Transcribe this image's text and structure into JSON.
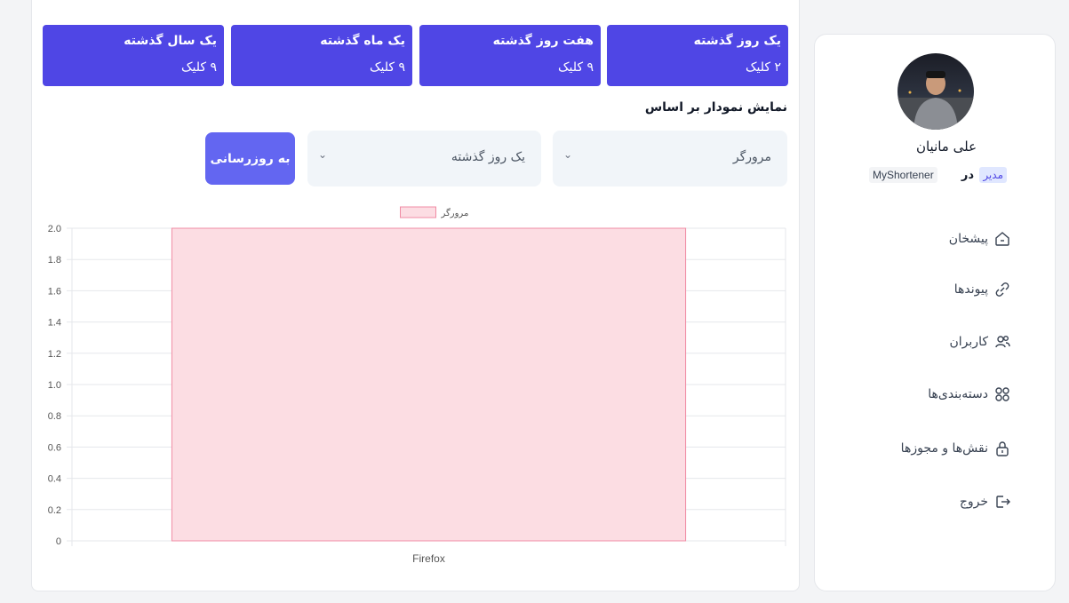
{
  "stats": [
    {
      "title": "یک روز گذشته",
      "value": "۲ کلیک"
    },
    {
      "title": "هفت روز گذشته",
      "value": "۹ کلیک"
    },
    {
      "title": "یک ماه گذشته",
      "value": "۹ کلیک"
    },
    {
      "title": "یک سال گذشته",
      "value": "۹ کلیک"
    }
  ],
  "filters": {
    "heading": "نمایش نمودار بر اساس",
    "type_value": "مرورگر",
    "period_value": "یک روز گذشته",
    "update_label": "به روزرسانی"
  },
  "colors": {
    "accent": "#4f46e5",
    "button": "#6366f1",
    "bar_fill": "#fcdde3",
    "bar_stroke": "#f08ca4"
  },
  "chart_data": {
    "type": "bar",
    "categories": [
      "Firefox"
    ],
    "series": [
      {
        "name": "مرورگر",
        "values": [
          2
        ]
      }
    ],
    "ylim": [
      0,
      2
    ],
    "yticks": [
      "0",
      "0.2",
      "0.4",
      "0.6",
      "0.8",
      "1.0",
      "1.2",
      "1.4",
      "1.6",
      "1.8",
      "2.0"
    ],
    "grid": true,
    "legend": "top"
  },
  "profile": {
    "name": "علی مانیان",
    "role": "مدیر",
    "in_word": "در",
    "org": "MyShortener"
  },
  "nav": [
    {
      "label": "پیشخان",
      "icon": "dashboard-icon"
    },
    {
      "label": "پیوندها",
      "icon": "link-icon"
    },
    {
      "label": "کاربران",
      "icon": "users-icon"
    },
    {
      "label": "دسته‌بندی‌ها",
      "icon": "categories-icon"
    },
    {
      "label": "نقش‌ها و مجوزها",
      "icon": "lock-icon"
    },
    {
      "label": "خروج",
      "icon": "logout-icon"
    }
  ]
}
